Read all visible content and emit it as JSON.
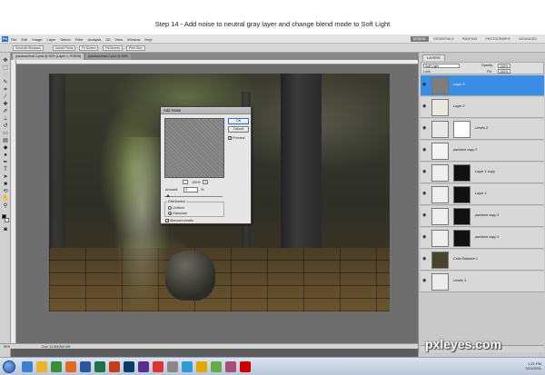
{
  "caption": "Step 14 - Add noise to neutral gray layer and change blend mode to Soft Light",
  "menubar": {
    "app_icon": "Ps",
    "menus": [
      "File",
      "Edit",
      "Image",
      "Layer",
      "Select",
      "Filter",
      "Analysis",
      "3D",
      "View",
      "Window",
      "Help"
    ],
    "workspaces": [
      "DESIGN",
      "ESSENTIALS",
      "PAINTING",
      "PHOTOGRAPHY",
      "ADVANCED"
    ]
  },
  "options": [
    "Scroll All Windows",
    "Actual Pixels",
    "Fit Screen",
    "Fill Screen",
    "Print Size"
  ],
  "doc_tabs": [
    "pandora-final-1.psd @ 50% (Layer 1, RGB/8)",
    "pandora-final-2.psd @ 50%"
  ],
  "status": {
    "zoom": "50%",
    "doc": "Doc: 12.6M/364.6M"
  },
  "dialog": {
    "title": "Add Noise",
    "ok": "OK",
    "cancel": "Cancel",
    "preview_label": "Preview",
    "zoom": "100%",
    "amount_label": "Amount:",
    "amount_value": "3",
    "amount_unit": "%",
    "distribution_label": "Distribution",
    "uniform": "Uniform",
    "gaussian": "Gaussian",
    "monochromatic": "Monochromatic",
    "minus": "-",
    "plus": "+",
    "slider_level": 0.06
  },
  "layers_panel": {
    "tab": "LAYERS",
    "blend_mode": "Soft Light",
    "opacity_label": "Opacity:",
    "opacity": "100%",
    "fill_label": "Fill:",
    "fill": "100%",
    "lock_label": "Lock:",
    "layers": [
      {
        "name": "Layer 3",
        "selected": true
      },
      {
        "name": "Layer 2",
        "selected": false
      },
      {
        "name": "Levels 2",
        "selected": false
      },
      {
        "name": "pandora copy 2",
        "selected": false
      },
      {
        "name": "Layer 1 copy",
        "selected": false
      },
      {
        "name": "Layer 1",
        "selected": false
      },
      {
        "name": "pandora copy 3",
        "selected": false
      },
      {
        "name": "pandora copy 4",
        "selected": false
      },
      {
        "name": "Color Balance 1",
        "selected": false
      },
      {
        "name": "Levels 1",
        "selected": false
      }
    ]
  },
  "watermark": "pxleyes.com",
  "clock": {
    "time": "1:22 PM",
    "date": "3/21/2011"
  },
  "colors": {
    "selected_layer": "#3a8ee6",
    "panel": "#c9c9c9",
    "workspace_bg": "#5d5d5d"
  }
}
